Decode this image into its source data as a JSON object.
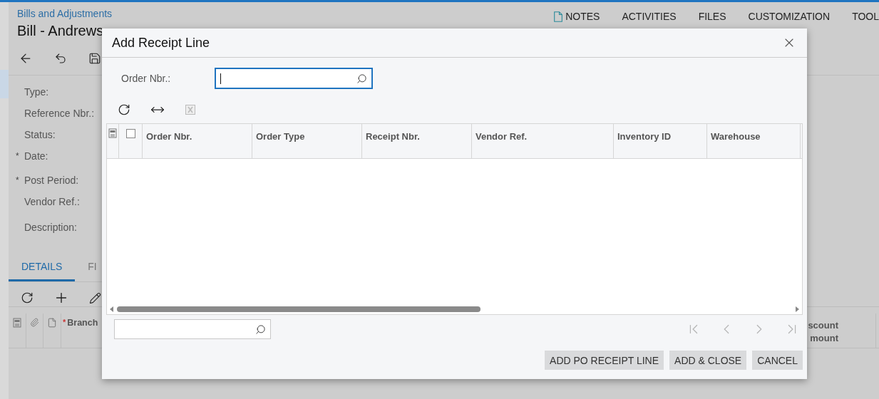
{
  "page": {
    "breadcrumb": "Bills and Adjustments",
    "title": "Bill - Andrews",
    "header_links": [
      {
        "label": "NOTES",
        "kind": "note"
      },
      {
        "label": "ACTIVITIES",
        "kind": "plain"
      },
      {
        "label": "FILES",
        "kind": "plain"
      },
      {
        "label": "CUSTOMIZATION",
        "kind": "plain"
      },
      {
        "label": "TOOL",
        "kind": "plain"
      }
    ],
    "toolbar": [
      {
        "kind": "back"
      },
      {
        "kind": "undo-save"
      },
      {
        "kind": "save"
      }
    ],
    "form_labels": [
      {
        "label": "Type:"
      },
      {
        "label": "Reference Nbr.:"
      },
      {
        "label": "Status:"
      },
      {
        "label": "Date:",
        "marker": "*"
      },
      {
        "label": "Post Period:",
        "marker": "*"
      },
      {
        "label": "Vendor Ref.:"
      },
      {
        "label": "Description:"
      }
    ],
    "tabs": [
      {
        "label": "DETAILS",
        "selected": true
      },
      {
        "label": "FI",
        "selected": false
      }
    ],
    "grid_toolbar": [
      {
        "kind": "refresh"
      },
      {
        "kind": "add"
      },
      {
        "kind": "edit"
      }
    ],
    "grid_columns": [
      {
        "label": "Branch",
        "marker": "*"
      }
    ],
    "grid_columns_right": [
      {
        "label": "scount mount"
      }
    ]
  },
  "dialog": {
    "title": "Add Receipt Line",
    "order_field": {
      "label": "Order Nbr.:",
      "focused": true
    },
    "toolbar": [
      {
        "kind": "refresh",
        "disabled": false
      },
      {
        "kind": "fit",
        "disabled": false
      },
      {
        "kind": "export",
        "disabled": true
      }
    ],
    "grid": {
      "select_all": {
        "checked": false
      },
      "columns": [
        {
          "label": "Order Nbr."
        },
        {
          "label": "Order Type"
        },
        {
          "label": "Receipt Nbr."
        },
        {
          "label": "Vendor Ref."
        },
        {
          "label": "Inventory ID"
        },
        {
          "label": "Warehouse"
        }
      ]
    },
    "pager": [
      {
        "kind": "first",
        "disabled": true
      },
      {
        "kind": "prev",
        "disabled": true
      },
      {
        "kind": "next",
        "disabled": true
      },
      {
        "kind": "last",
        "disabled": true
      }
    ],
    "buttons": [
      {
        "label": "ADD PO RECEIPT LINE"
      },
      {
        "label": "ADD & CLOSE"
      },
      {
        "label": "CANCEL"
      }
    ]
  }
}
